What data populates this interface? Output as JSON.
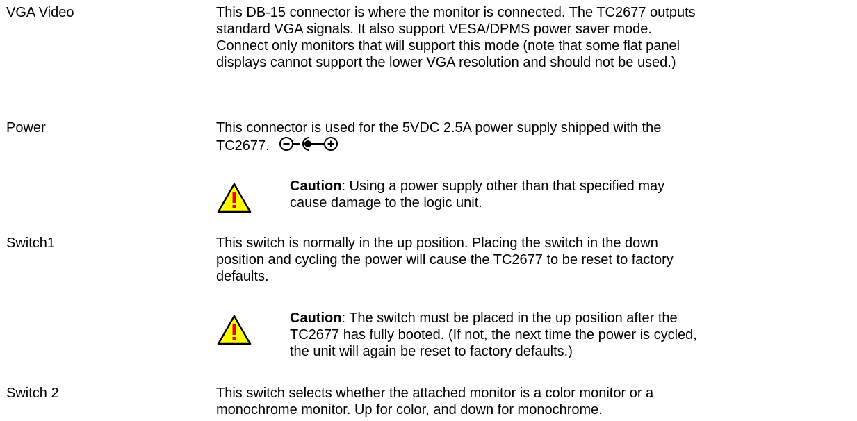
{
  "rows": [
    {
      "term": "VGA Video",
      "desc": "This DB-15 connector is where the monitor is connected.  The TC2677 outputs standard VGA signals.  It also support VESA/DPMS power saver mode.  Connect only monitors that will support this mode (note that some flat panel displays cannot support the lower VGA resolution and should not be used.)"
    },
    {
      "term": "Power",
      "desc": "This connector is used for the 5VDC 2.5A power supply shipped with the TC2677.",
      "caution_label": "Caution",
      "caution_text": ":  Using a power supply other than that specified may cause damage to the logic unit."
    },
    {
      "term": "Switch1",
      "desc": "This switch is normally in the up position.  Placing the switch in the down position and cycling the power will cause the TC2677 to be reset to factory defaults.",
      "caution_label": "Caution",
      "caution_text": ": The switch must be placed in the up position after the TC2677 has fully booted.  (If not, the next time the power is cycled, the unit will again be reset to factory defaults.)"
    },
    {
      "term": "Switch 2",
      "desc": "This switch selects whether the attached monitor is a color monitor or a monochrome monitor.  Up for color, and down for monochrome."
    }
  ],
  "icons": {
    "warning": "warning-triangle-icon",
    "polarity": "center-positive-polarity-icon"
  },
  "colors": {
    "warning_fill": "#FFFF00",
    "warning_mark": "#E8000B",
    "text": "#000000"
  }
}
